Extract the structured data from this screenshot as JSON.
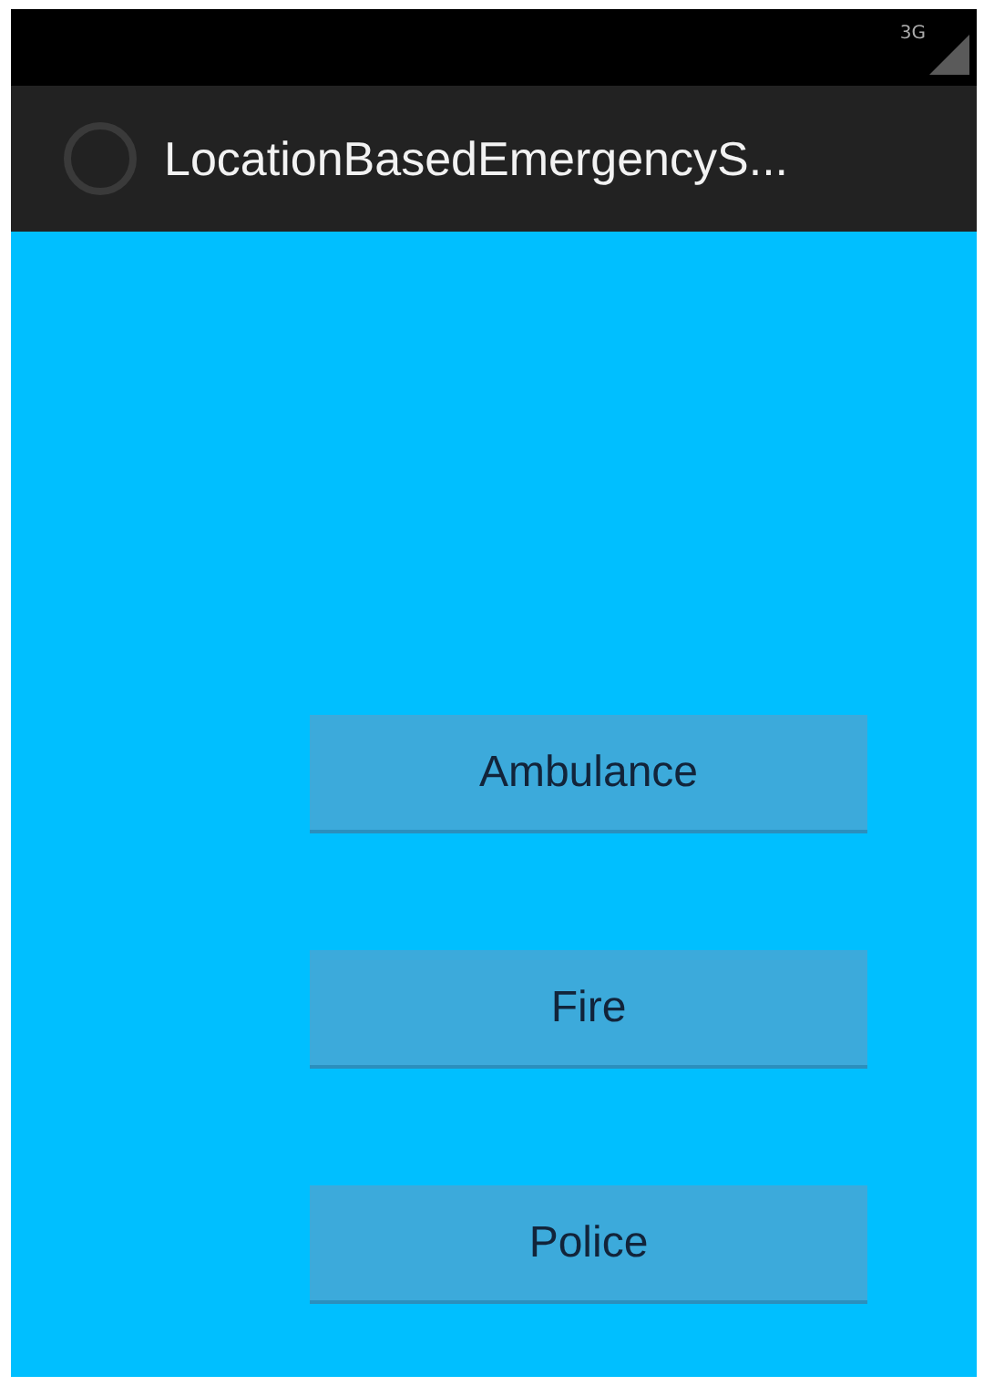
{
  "status_bar": {
    "network": "3G"
  },
  "action_bar": {
    "title": "LocationBasedEmergencyS..."
  },
  "buttons": [
    {
      "label": "Ambulance"
    },
    {
      "label": "Fire"
    },
    {
      "label": "Police"
    }
  ]
}
